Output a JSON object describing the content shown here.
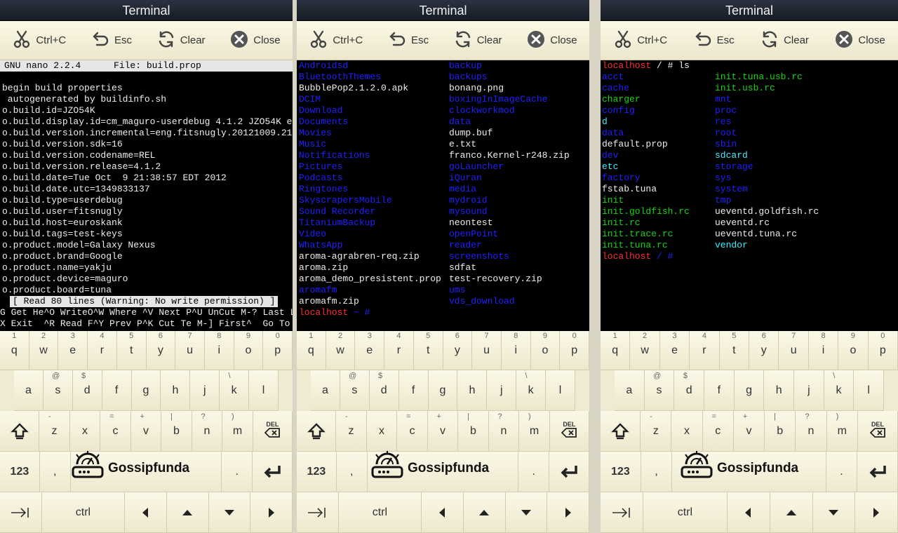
{
  "title": "Terminal",
  "toolbar": {
    "ctrlc": "Ctrl+C",
    "esc": "Esc",
    "clear": "Clear",
    "close": "Close"
  },
  "watermark": "Gossipfunda",
  "panel1": {
    "header": "GNU nano 2.2.4      File: build.prop",
    "lines": [
      "",
      "begin build properties",
      " autogenerated by buildinfo.sh",
      "o.build.id=JZO54K",
      "o.build.display.id=cm_maguro-userdebug 4.1.2 JZO54K e$",
      "o.build.version.incremental=eng.fitsnugly.20121009.21$",
      "o.build.version.sdk=16",
      "o.build.version.codename=REL",
      "o.build.version.release=4.1.2",
      "o.build.date=Tue Oct  9 21:38:57 EDT 2012",
      "o.build.date.utc=1349833137",
      "o.build.type=userdebug",
      "o.build.user=fitsnugly",
      "o.build.host=euroskank",
      "o.build.tags=test-keys",
      "o.product.model=Galaxy Nexus",
      "o.product.brand=Google",
      "o.product.name=yakju",
      "o.product.device=maguro",
      "o.product.board=tuna"
    ],
    "status": "[ Read 80 lines (Warning: No write permission) ]",
    "keys1": "G Get He^O WriteO^W Where ^V Next P^U UnCut M-? Last L",
    "keys2": "X Exit  ^R Read F^Y Prev P^K Cut Te M-] First^  Go To L"
  },
  "panel2": {
    "left": [
      [
        "Androidsd",
        "dir"
      ],
      [
        "BluetoothThemes",
        "dir"
      ],
      [
        "BubblePop2.1.2.0.apk",
        "plain"
      ],
      [
        "DCIM",
        "dir"
      ],
      [
        "Download",
        "dir"
      ],
      [
        "Documents",
        "dir"
      ],
      [
        "Movies",
        "dir"
      ],
      [
        "Music",
        "dir"
      ],
      [
        "Notifications",
        "dir"
      ],
      [
        "Pictures",
        "dir"
      ],
      [
        "Podcasts",
        "dir"
      ],
      [
        "Ringtones",
        "dir"
      ],
      [
        "SkyscrapersMobile",
        "dir"
      ],
      [
        "Sound Recorder",
        "dir"
      ],
      [
        "TitaniumBackup",
        "dir"
      ],
      [
        "Video",
        "dir"
      ],
      [
        "WhatsApp",
        "dir"
      ],
      [
        "aroma-agrabren-req.zip",
        "plain"
      ],
      [
        "aroma.zip",
        "plain"
      ],
      [
        "aroma_demo_presistent.prop",
        "plain"
      ],
      [
        "aromafm",
        "dir"
      ],
      [
        "aromafm.zip",
        "plain"
      ]
    ],
    "right": [
      [
        "backup",
        "dir"
      ],
      [
        "backups",
        "dir"
      ],
      [
        "bonang.png",
        "plain"
      ],
      [
        "boxingInImageCache",
        "dir"
      ],
      [
        "clockworkmod",
        "dir"
      ],
      [
        "data",
        "dir"
      ],
      [
        "dump.buf",
        "plain"
      ],
      [
        "e.txt",
        "plain"
      ],
      [
        "franco.Kernel-r248.zip",
        "plain"
      ],
      [
        "goLauncher",
        "dir"
      ],
      [
        "iQuran",
        "dir"
      ],
      [
        "media",
        "dir"
      ],
      [
        "mydroid",
        "dir"
      ],
      [
        "mysound",
        "dir"
      ],
      [
        "neontest",
        "plain"
      ],
      [
        "openPoint",
        "dir"
      ],
      [
        "reader",
        "dir"
      ],
      [
        "screenshots",
        "dir"
      ],
      [
        "sdfat",
        "plain"
      ],
      [
        "test-recovery.zip",
        "plain"
      ],
      [
        "ums",
        "dir"
      ],
      [
        "vds_download",
        "dir"
      ]
    ],
    "prompt": "localhost",
    "prompt_tail": " ~ #"
  },
  "panel3": {
    "prompt": "localhost",
    "cmd": " / # ls",
    "prompt_tail": " / #",
    "left": [
      [
        "acct",
        "dir"
      ],
      [
        "cache",
        "dir"
      ],
      [
        "charger",
        "ex"
      ],
      [
        "config",
        "dir"
      ],
      [
        "d",
        "ln"
      ],
      [
        "data",
        "dir"
      ],
      [
        "default.prop",
        "plain"
      ],
      [
        "dev",
        "dir"
      ],
      [
        "etc",
        "ln"
      ],
      [
        "factory",
        "dir"
      ],
      [
        "fstab.tuna",
        "plain"
      ],
      [
        "init",
        "ex"
      ],
      [
        "init.goldfish.rc",
        "ex"
      ],
      [
        "init.rc",
        "ex"
      ],
      [
        "init.trace.rc",
        "ex"
      ],
      [
        "init.tuna.rc",
        "ex"
      ]
    ],
    "right": [
      [
        "init.tuna.usb.rc",
        "ex"
      ],
      [
        "init.usb.rc",
        "ex"
      ],
      [
        "mnt",
        "dir"
      ],
      [
        "proc",
        "dir"
      ],
      [
        "res",
        "dir"
      ],
      [
        "root",
        "dir"
      ],
      [
        "sbin",
        "dir"
      ],
      [
        "sdcard",
        "ln"
      ],
      [
        "storage",
        "dir"
      ],
      [
        "sys",
        "dir"
      ],
      [
        "system",
        "dir"
      ],
      [
        "tmp",
        "dir"
      ],
      [
        "ueventd.goldfish.rc",
        "plain"
      ],
      [
        "ueventd.rc",
        "plain"
      ],
      [
        "ueventd.tuna.rc",
        "plain"
      ],
      [
        "vendor",
        "ln"
      ]
    ]
  },
  "keyboard": {
    "row1": [
      "q",
      "w",
      "e",
      "r",
      "t",
      "y",
      "u",
      "i",
      "o",
      "p"
    ],
    "row1_sup": [
      "1",
      "2",
      "3",
      "4",
      "5",
      "6",
      "7",
      "8",
      "9",
      "0"
    ],
    "row2": [
      "a",
      "s",
      "d",
      "f",
      "g",
      "h",
      "j",
      "k",
      "l"
    ],
    "row2_sup": [
      "",
      "@",
      "$",
      "",
      "",
      "",
      "",
      "\\",
      ""
    ],
    "row3": [
      "z",
      "x",
      "c",
      "v",
      "b",
      "n",
      "m"
    ],
    "row3_sup": [
      "-",
      "",
      "=",
      "+",
      "|",
      "?",
      ")"
    ],
    "del": "DEL",
    "num": "123",
    "comma": ",",
    "period": ".",
    "ctrl": "ctrl"
  }
}
